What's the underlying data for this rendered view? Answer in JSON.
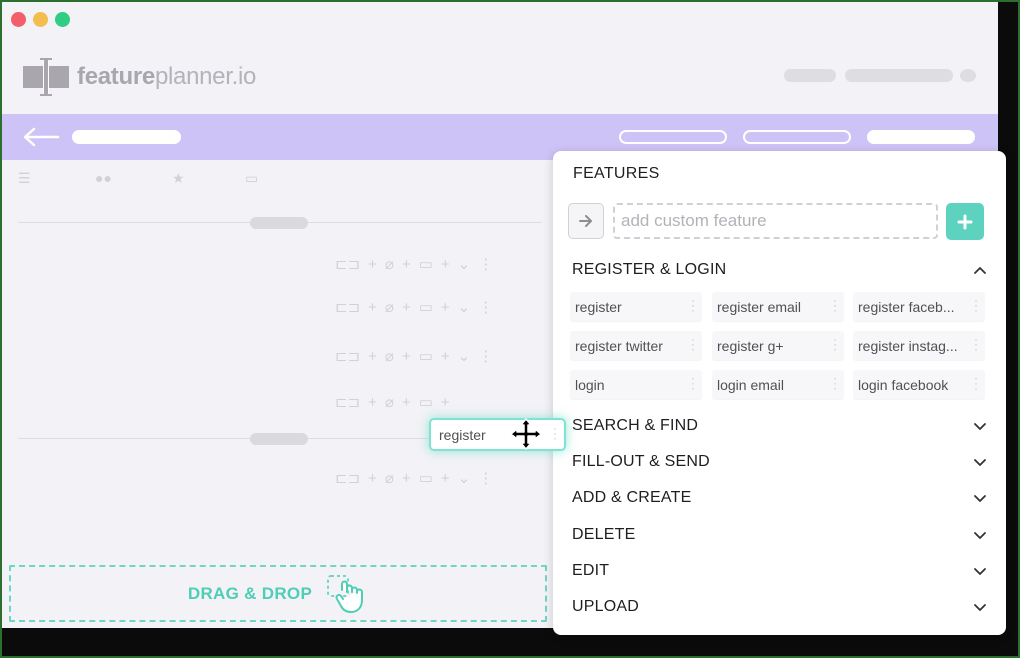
{
  "app": {
    "logo_bold": "feature",
    "logo_rest": "planner.io"
  },
  "workspace": {
    "drop_zone_label": "DRAG & DROP"
  },
  "features_panel": {
    "title": "FEATURES",
    "custom_input_placeholder": "add custom feature",
    "sections": [
      {
        "label": "REGISTER & LOGIN",
        "expanded": true
      },
      {
        "label": "SEARCH & FIND",
        "expanded": false
      },
      {
        "label": "FILL-OUT & SEND",
        "expanded": false
      },
      {
        "label": "ADD & CREATE",
        "expanded": false
      },
      {
        "label": "DELETE",
        "expanded": false
      },
      {
        "label": "EDIT",
        "expanded": false
      },
      {
        "label": "UPLOAD",
        "expanded": false
      }
    ],
    "register_login_items": [
      "register",
      "register email",
      "register faceb...",
      "register twitter",
      "register g+",
      "register instag...",
      "login",
      "login email",
      "login facebook"
    ]
  },
  "dragging_item": {
    "label": "register"
  },
  "colors": {
    "accent_teal": "#5dd3bf",
    "header_purple": "#cec3f6",
    "window_bg": "#f3f2f6"
  },
  "icons": {
    "back": "back-arrow-icon",
    "add": "plus-icon",
    "go": "arrow-right-icon",
    "expand": "chevron-down-icon",
    "collapse": "chevron-up-icon",
    "move": "move-cursor-icon",
    "drag": "hand-drag-icon"
  }
}
